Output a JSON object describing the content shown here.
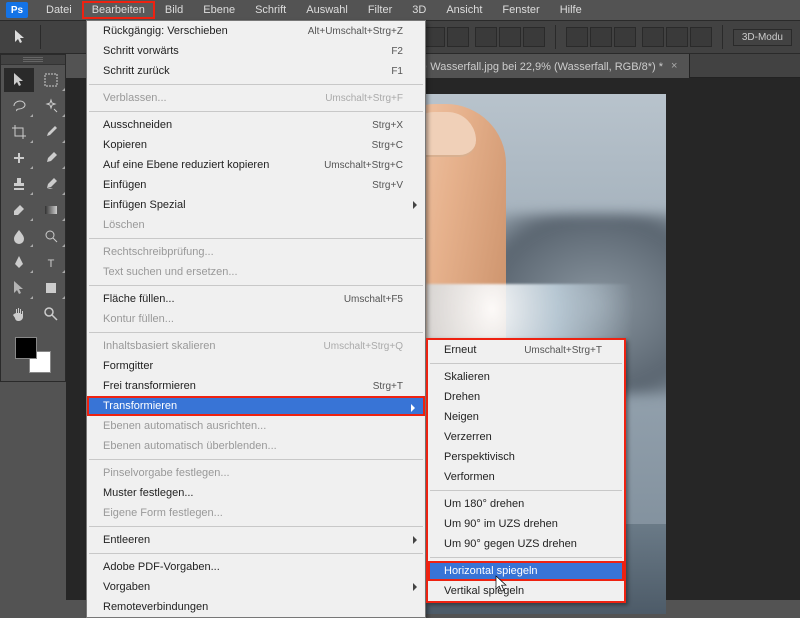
{
  "logo": "Ps",
  "menubar": {
    "items": [
      "Datei",
      "Bearbeiten",
      "Bild",
      "Ebene",
      "Schrift",
      "Auswahl",
      "Filter",
      "3D",
      "Ansicht",
      "Fenster",
      "Hilfe"
    ],
    "highlight_index": 1
  },
  "optionbar": {
    "mode_label": "3D-Modu"
  },
  "document_tabs": {
    "tab1_label": "⊙ Wasserfall.jpg bei 22,9% (Wasserfall, RGB/8*) *"
  },
  "edit_menu": {
    "items": [
      {
        "label": "Rückgängig: Verschieben",
        "shortcut": "Alt+Umschalt+Strg+Z"
      },
      {
        "label": "Schritt vorwärts",
        "shortcut": "F2"
      },
      {
        "label": "Schritt zurück",
        "shortcut": "F1"
      },
      {
        "sep": true
      },
      {
        "label": "Verblassen...",
        "shortcut": "Umschalt+Strg+F",
        "dis": true
      },
      {
        "sep": true
      },
      {
        "label": "Ausschneiden",
        "shortcut": "Strg+X"
      },
      {
        "label": "Kopieren",
        "shortcut": "Strg+C"
      },
      {
        "label": "Auf eine Ebene reduziert kopieren",
        "shortcut": "Umschalt+Strg+C"
      },
      {
        "label": "Einfügen",
        "shortcut": "Strg+V"
      },
      {
        "label": "Einfügen Spezial",
        "sub": true
      },
      {
        "label": "Löschen",
        "dis": true
      },
      {
        "sep": true
      },
      {
        "label": "Rechtschreibprüfung...",
        "dis": true
      },
      {
        "label": "Text suchen und ersetzen...",
        "dis": true
      },
      {
        "sep": true
      },
      {
        "label": "Fläche füllen...",
        "shortcut": "Umschalt+F5"
      },
      {
        "label": "Kontur füllen...",
        "dis": true
      },
      {
        "sep": true
      },
      {
        "label": "Inhaltsbasiert skalieren",
        "shortcut": "Umschalt+Strg+Q",
        "dis": true
      },
      {
        "label": "Formgitter"
      },
      {
        "label": "Frei transformieren",
        "shortcut": "Strg+T"
      },
      {
        "label": "Transformieren",
        "sub": true,
        "hl": "blue"
      },
      {
        "label": "Ebenen automatisch ausrichten...",
        "dis": true
      },
      {
        "label": "Ebenen automatisch überblenden...",
        "dis": true
      },
      {
        "sep": true
      },
      {
        "label": "Pinselvorgabe festlegen...",
        "dis": true
      },
      {
        "label": "Muster festlegen..."
      },
      {
        "label": "Eigene Form festlegen...",
        "dis": true
      },
      {
        "sep": true
      },
      {
        "label": "Entleeren",
        "sub": true
      },
      {
        "sep": true
      },
      {
        "label": "Adobe PDF-Vorgaben..."
      },
      {
        "label": "Vorgaben",
        "sub": true
      },
      {
        "label": "Remoteverbindungen"
      }
    ]
  },
  "transform_menu": {
    "items": [
      {
        "label": "Erneut",
        "shortcut": "Umschalt+Strg+T"
      },
      {
        "sep": true
      },
      {
        "label": "Skalieren"
      },
      {
        "label": "Drehen"
      },
      {
        "label": "Neigen"
      },
      {
        "label": "Verzerren"
      },
      {
        "label": "Perspektivisch"
      },
      {
        "label": "Verformen"
      },
      {
        "sep": true
      },
      {
        "label": "Um 180° drehen"
      },
      {
        "label": "Um 90° im UZS drehen"
      },
      {
        "label": "Um 90° gegen UZS drehen"
      },
      {
        "sep": true
      },
      {
        "label": "Horizontal spiegeln",
        "hl": "blue-red"
      },
      {
        "label": "Vertikal spiegeln"
      }
    ]
  },
  "tool_icons": [
    "move",
    "marquee",
    "lasso",
    "magic",
    "crop",
    "eyedrop",
    "heal",
    "brush",
    "stamp",
    "history",
    "eraser",
    "gradient",
    "blur",
    "dodge",
    "pen",
    "text",
    "path",
    "shape",
    "hand",
    "zoom"
  ]
}
